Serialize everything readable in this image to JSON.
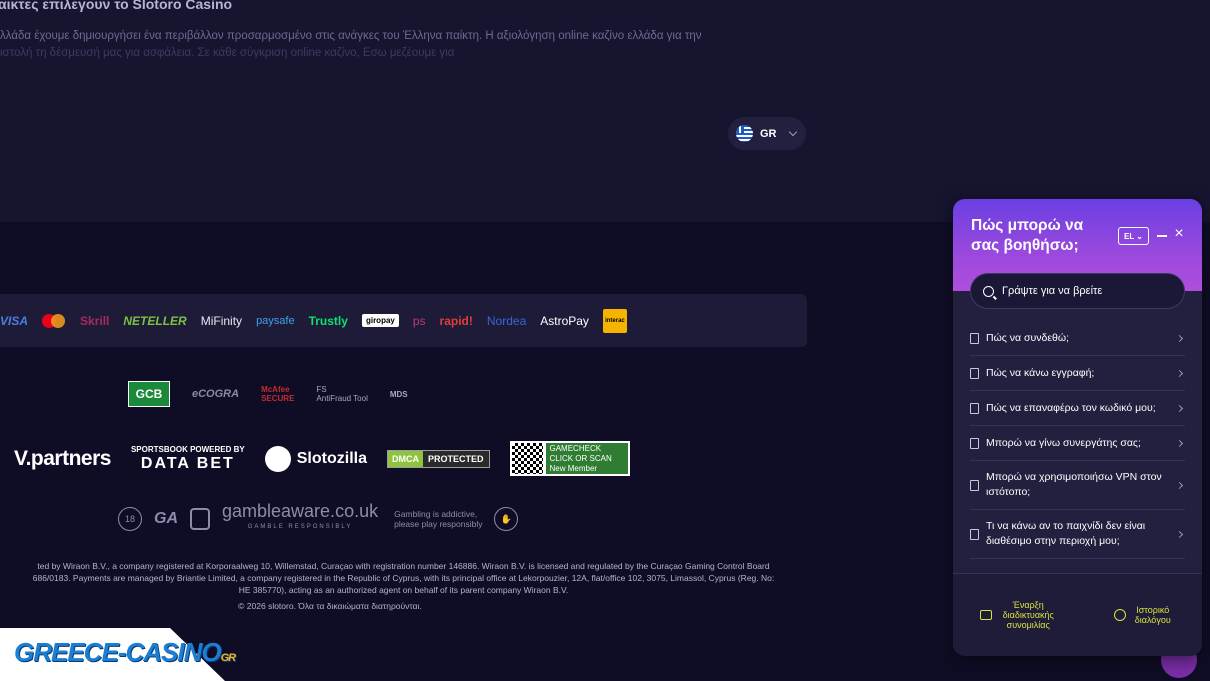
{
  "top": {
    "heading": "αικτες επιλεγουν το Slotoro Casino",
    "para_line1": "λλάδα έχουμε δημιουργήσει ένα περιβάλλον προσαρμοσμένο στις ανάγκες του Έλληνα παίκτη. Η αξιολόγηση online καζίνο ελλάδα για την",
    "para_line2": "ιστολή τη δέσμευσή μας για ασφάλεια. Σε κάθε σύγκριση online καζίνο, Εσω μεζέουμε για",
    "language": "GR"
  },
  "payments": [
    "VISA",
    "Skrill",
    "NETELLER",
    "MiFinity",
    "paysafe",
    "Trustly",
    "giropay",
    "ps",
    "rapid!",
    "Nordea",
    "AstroPay",
    "interac"
  ],
  "certs": {
    "gcb": "GCB",
    "ecogra": "eCOGRA",
    "mcafee_line1": "McAfee",
    "mcafee_line2": "SECURE",
    "fs_line1": "FS",
    "fs_line2": "AntiFraud Tool",
    "mds": "MDS"
  },
  "partners": {
    "vpartners": "V.partners",
    "databet_top": "SPORTSBOOK POWERED BY",
    "databet_main": "DATA BET",
    "slotozilla": "Slotozilla",
    "dmca_left": "DMCA",
    "dmca_right": "PROTECTED",
    "gamecheck_title": "GAMECHECK",
    "gamecheck_sub": "CLICK OR SCAN",
    "gamecheck_member": "New Member"
  },
  "responsible": {
    "age": "18",
    "ga": "GA",
    "gambleaware": "gambleaware.co.uk",
    "gambleaware_sub": "GAMBLE RESPONSIBLY",
    "addictive_line1": "Gambling is addictive,",
    "addictive_line2": "please play responsibly"
  },
  "legal": {
    "line1": "ted by Wiraon B.V., a company registered at Korporaalweg 10, Willemstad, Curaçao with registration number 146886. Wiraon B.V. is licensed and regulated by the Curaçao Gaming Control Board",
    "line2": "686/0183. Payments are managed by Briantie Limited, a company registered in the Republic of Cyprus, with its principal office at Lekorpouzier, 12A, flat/office 102, 3075, Limassol, Cyprus (Reg. No:",
    "line3": "HE 385770), acting as an authorized agent on behalf of its parent company Wiraon B.V.",
    "copyright": "© 2026 slotoro. Όλα τα δικαιώματα διατηρούνται."
  },
  "watermark": {
    "name": "GREECE-CASINO",
    "suffix": "GR"
  },
  "widget": {
    "title": "Πώς μπορώ να σας βοηθήσω;",
    "lang": "EL",
    "search_placeholder": "Γράψτε για να βρείτε",
    "items": [
      {
        "label": "Πώς να συνδεθώ;"
      },
      {
        "label": "Πώς να κάνω εγγραφή;"
      },
      {
        "label": "Πώς να επαναφέρω τον κωδικό μου;"
      },
      {
        "label": "Μπορώ να γίνω συνεργάτης σας;"
      },
      {
        "label": "Μπορώ να χρησιμοποιήσω VPN στον ιστότοπο;"
      },
      {
        "label": "Τι να κάνω αν το παιχνίδι δεν είναι διαθέσιμο στην περιοχή μου;"
      }
    ],
    "start_chat": "Έναρξη διαδικτυακής συνομιλίας",
    "history": "Ιστορικό διαλόγου"
  },
  "colors": {
    "background": "#0f0d26",
    "widget_accent": "#7a42e0",
    "link_yellow": "#d9e23a"
  }
}
